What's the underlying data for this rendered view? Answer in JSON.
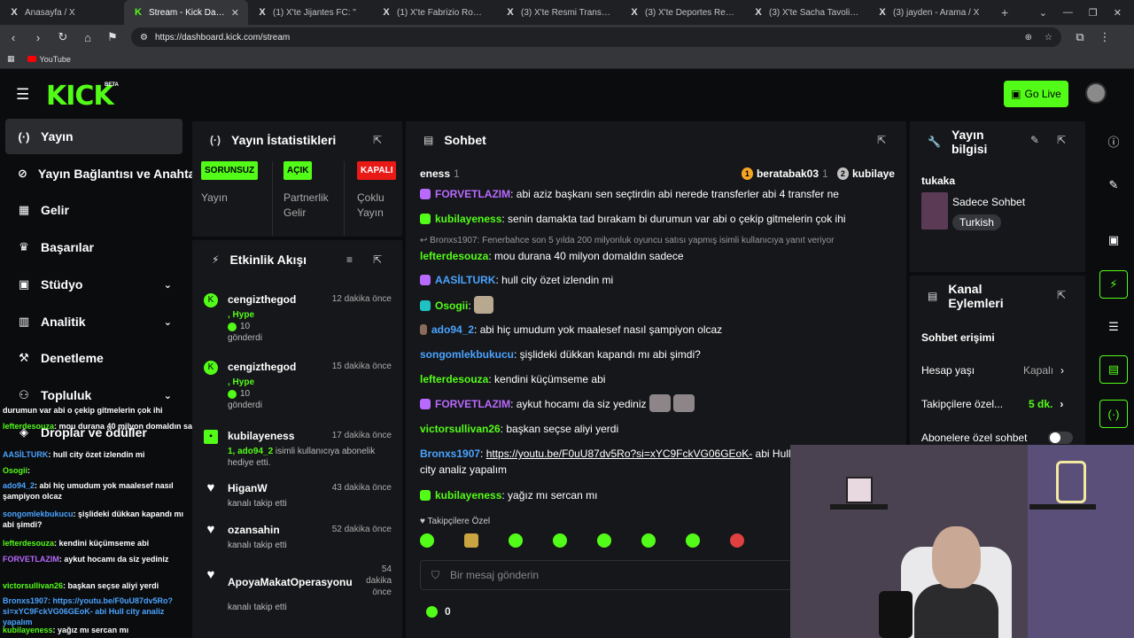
{
  "browser": {
    "tabs": [
      {
        "icon": "X",
        "title": "Anasayfa / X",
        "active": false
      },
      {
        "icon": "K",
        "title": "Stream - Kick Dashboard",
        "active": true
      },
      {
        "icon": "X",
        "title": "(1) X'te Jijantes FC: \"",
        "active": false
      },
      {
        "icon": "X",
        "title": "(1) X'te Fabrizio Romano: \"",
        "active": false
      },
      {
        "icon": "X",
        "title": "(3) X'te Resmi Transfer: \"Oyun",
        "active": false
      },
      {
        "icon": "X",
        "title": "(3) X'te Deportes Reports: \"Ga",
        "active": false
      },
      {
        "icon": "X",
        "title": "(3) X'te Sacha Tavolieri: \"",
        "active": false
      },
      {
        "icon": "X",
        "title": "(3) jayden - Arama / X",
        "active": false
      }
    ],
    "url": "https://dashboard.kick.com/stream",
    "bookmark": "YouTube"
  },
  "header": {
    "logo": "KICK",
    "beta": "BETA",
    "go_live": "Go Live"
  },
  "sidebar": {
    "items": [
      {
        "label": "Yayın",
        "icon": "(·)"
      },
      {
        "label": "Yayın Bağlantısı ve Anahtarı",
        "icon": "⊘"
      },
      {
        "label": "Gelir",
        "icon": "▦"
      },
      {
        "label": "Başarılar",
        "icon": "♛"
      },
      {
        "label": "Stüdyo",
        "icon": "▣"
      },
      {
        "label": "Analitik",
        "icon": "▥"
      },
      {
        "label": "Denetleme",
        "icon": "⚒"
      },
      {
        "label": "Topluluk",
        "icon": "⚇"
      },
      {
        "label": "Droplar ve ödüller",
        "icon": "◈"
      }
    ]
  },
  "overlay_chat": [
    {
      "user": "",
      "text": "durumun var abi o çekip gitmelerin çok ihi"
    },
    {
      "user": "lefterdesouza",
      "text": ": mou durana 40 milyon domaldın sadece"
    },
    {
      "user": "AASİLTURK",
      "text": ": hull city özet izlendin mi"
    },
    {
      "user": "Osogii",
      "text": ":"
    },
    {
      "user": "ado94_2",
      "text": ": abi hiç umudum yok maalesef nasıl şampiyon olcaz"
    },
    {
      "user": "songomlekbukucu",
      "text": ": şişlideki dükkan kapandı mı abi şimdi?"
    },
    {
      "user": "lefterdesouza",
      "text": ": kendini küçümseme abi"
    },
    {
      "user": "FORVETLAZIM",
      "text": ": aykut hocamı da siz yediniz"
    },
    {
      "user": "victorsullivan26",
      "text": ": başkan seçse aliyi yerdi"
    },
    {
      "user": "Bronxs1907",
      "text": ": https://youtu.be/F0uU87dv5Ro?si=xYC9FckVG06GEoK- abi Hull city analiz yapalım"
    },
    {
      "user": "kubilayeness",
      "text": ": yağız mı sercan mı"
    }
  ],
  "stats": {
    "title": "Yayın İstatistikleri",
    "cols": [
      {
        "badge": "SORUNSUZ",
        "label": "Yayın"
      },
      {
        "badge": "AÇIK",
        "label": "Partnerlik Gelir"
      },
      {
        "badge": "KAPALI",
        "label": "Çoklu Yayın"
      }
    ]
  },
  "activity": {
    "title": "Etkinlik Akışı",
    "items": [
      {
        "name": "cengizthegod",
        "time": "12 dakika önce",
        "hype": ", Hype",
        "count": "10",
        "desc": "gönderdi"
      },
      {
        "name": "cengizthegod",
        "time": "15 dakika önce",
        "hype": ", Hype",
        "count": "10",
        "desc": "gönderdi"
      },
      {
        "name": "kubilayeness",
        "time": "17 dakika önce",
        "hl": "1, ado94_2",
        "desc": " isimli kullanıcıya abonelik hediye etti."
      },
      {
        "name": "HiganW",
        "time": "43 dakika önce",
        "desc": "kanalı takip etti"
      },
      {
        "name": "ozansahin",
        "time": "52 dakika önce",
        "desc": "kanalı takip etti"
      },
      {
        "name": "ApoyaMakatOperasyonu",
        "time": "54 dakika önce",
        "desc": "kanalı takip etti"
      }
    ]
  },
  "chat": {
    "title": "Sohbet",
    "top_gifters": [
      {
        "name": "eness",
        "count": "1"
      },
      {
        "name": "beratabak03",
        "count": "1"
      },
      {
        "name": "kubilaye",
        "count": ""
      }
    ],
    "messages": [
      {
        "user": "FORVETLAZIM",
        "color": "#b86aff",
        "text": ": abi aziz başkanı sen seçtirdin abi nerede transferler abi 4 transfer ne"
      },
      {
        "user": "kubilayeness",
        "color": "#53fc18",
        "text": ": senin damakta tad bırakam bi durumun var abi o çekip gitmelerin çok ihi"
      },
      {
        "reply": "Bronxs1907: Fenerbahce son 5 yılda 200 milyonluk oyuncu satısı yapmış isimli kullanıcıya yanıt veriyor"
      },
      {
        "user": "lefterdesouza",
        "color": "#53fc18",
        "text": ": mou durana 40 milyon domaldın sadece"
      },
      {
        "user": "AASİLTURK",
        "color": "#4aa3ff",
        "text": ": hull city özet izlendin mi"
      },
      {
        "user": "Osogii",
        "color": "#53fc18",
        "text": ":"
      },
      {
        "user": "ado94_2",
        "color": "#4aa3ff",
        "text": ": abi hiç umudum yok maalesef nasıl şampiyon olcaz"
      },
      {
        "user": "songomlekbukucu",
        "color": "#4aa3ff",
        "text": ": şişlideki dükkan kapandı mı abi şimdi?"
      },
      {
        "user": "lefterdesouza",
        "color": "#53fc18",
        "text": ": kendini küçümseme abi"
      },
      {
        "user": "FORVETLAZIM",
        "color": "#b86aff",
        "text": ": aykut hocamı da siz yediniz"
      },
      {
        "user": "victorsullivan26",
        "color": "#53fc18",
        "text": ": başkan seçse aliyi yerdi"
      },
      {
        "user": "Bronxs1907",
        "color": "#4aa3ff",
        "link": "https://youtu.be/F0uU87dv5Ro?si=xYC9FckVG06GEoK-",
        "text": " abi Hull city analiz yapalım"
      },
      {
        "user": "kubilayeness",
        "color": "#53fc18",
        "text": ": yağız mı sercan mı"
      }
    ],
    "followers_only": "Takipçilere Özel",
    "placeholder": "Bir mesaj gönderin",
    "points": "0"
  },
  "stream_info": {
    "title": "Yayın bilgisi",
    "channel": "tukaka",
    "category": "Sadece Sohbet",
    "language": "Turkish"
  },
  "channel_actions": {
    "title": "Kanal Eylemleri",
    "section": "Sohbet erişimi",
    "rows": [
      {
        "label": "Hesap yaşı",
        "value": "Kapalı"
      },
      {
        "label": "Takipçilere özel...",
        "value": "5 dk."
      },
      {
        "label": "Abonelere özel sohbet",
        "value": ""
      }
    ]
  },
  "colors": {
    "accent": "#53fc18",
    "bg": "#0b0c0e",
    "panel": "#16171a",
    "danger": "#e91916"
  }
}
